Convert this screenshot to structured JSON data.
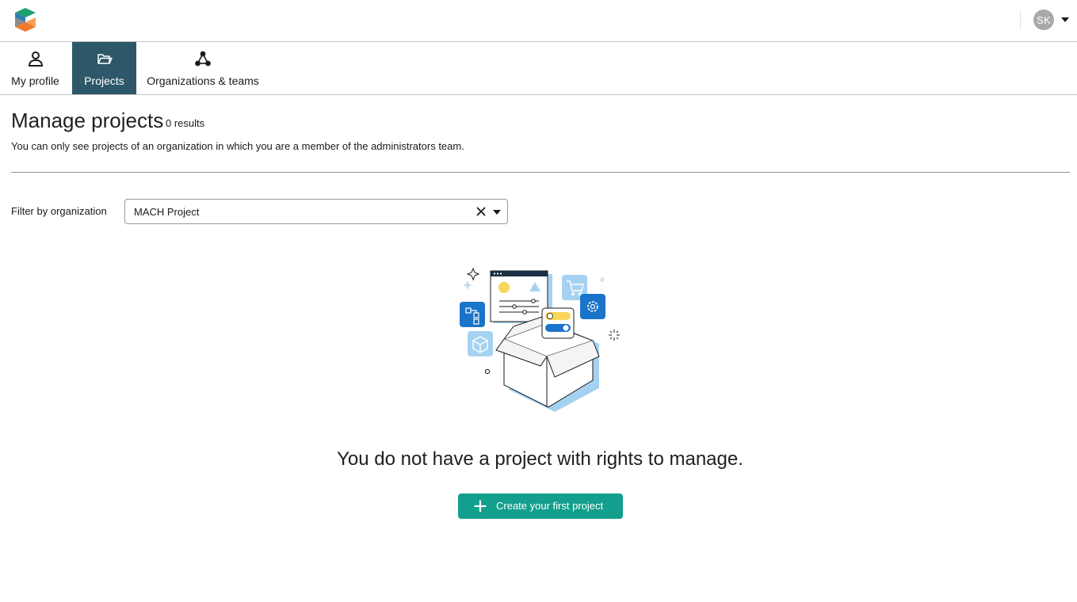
{
  "header": {
    "logo_icon": "product-logo",
    "user_initials": "SK",
    "user_menu_icon": "caret-down-icon"
  },
  "nav": {
    "tabs": [
      {
        "label": "My profile",
        "icon": "user-icon",
        "active": false
      },
      {
        "label": "Projects",
        "icon": "folder-open-icon",
        "active": true
      },
      {
        "label": "Organizations & teams",
        "icon": "network-icon",
        "active": false
      }
    ],
    "active_color": "#2d5869"
  },
  "page": {
    "title": "Manage projects",
    "results": "0 results",
    "subtitle": "You can only see projects of an organization in which you are a member of the administrators team."
  },
  "filter": {
    "label": "Filter by organization",
    "value": "MACH Project",
    "clear_icon": "close-icon",
    "dropdown_icon": "caret-down-icon"
  },
  "empty_state": {
    "illustration": "open-box-illustration",
    "message": "You do not have a project with rights to manage.",
    "button_label": "Create your first project",
    "button_icon": "plus-icon",
    "button_color": "#139f8d"
  }
}
